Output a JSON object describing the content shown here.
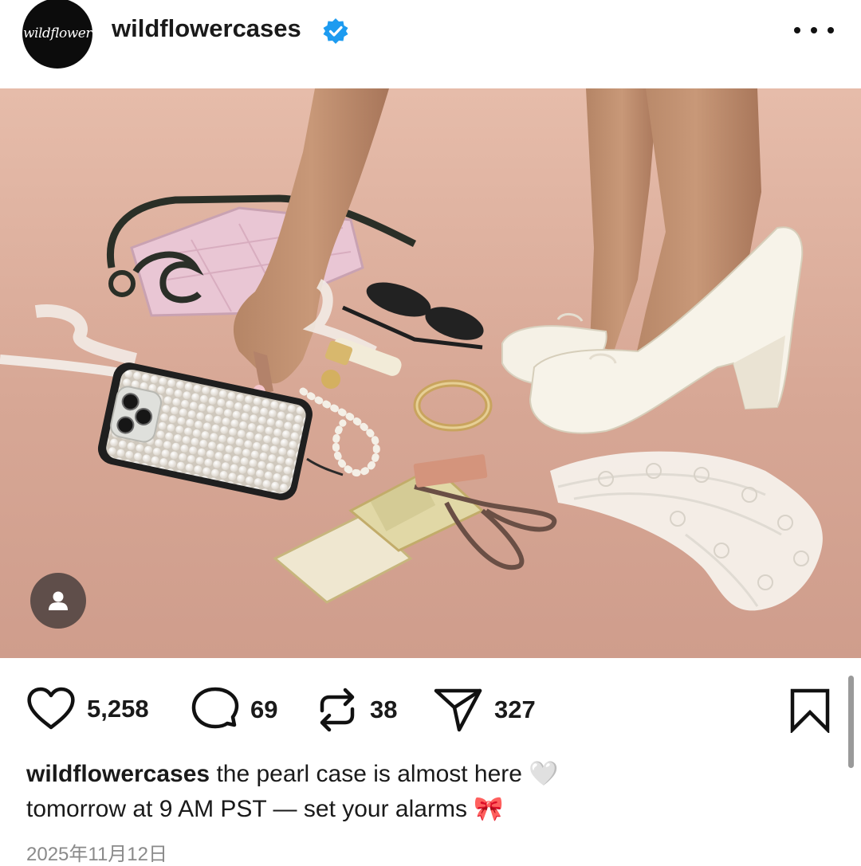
{
  "post": {
    "username": "wildflowercases",
    "avatar_text": "wildflower",
    "verified": true,
    "header_icons": {
      "verified": "verified-badge-icon",
      "more": "more-options-icon"
    }
  },
  "media": {
    "user_tag_icon": "person-icon"
  },
  "actions": {
    "likes": "5,258",
    "comments": "69",
    "reposts": "38",
    "shares": "327",
    "icons": [
      "heart-icon",
      "comment-icon",
      "repost-icon",
      "share-icon",
      "bookmark-icon"
    ]
  },
  "caption": {
    "username": "wildflowercases",
    "line1": "the pearl case is almost here 🤍",
    "line2": "tomorrow at 9 AM PST — set your alarms 🎀"
  },
  "timestamp": "2025年11月12日",
  "colors": {
    "verified_blue": "#1d9bf0",
    "carpet": "#d9ac9c",
    "text": "#1a1a1a",
    "muted": "#8a8a8a"
  }
}
